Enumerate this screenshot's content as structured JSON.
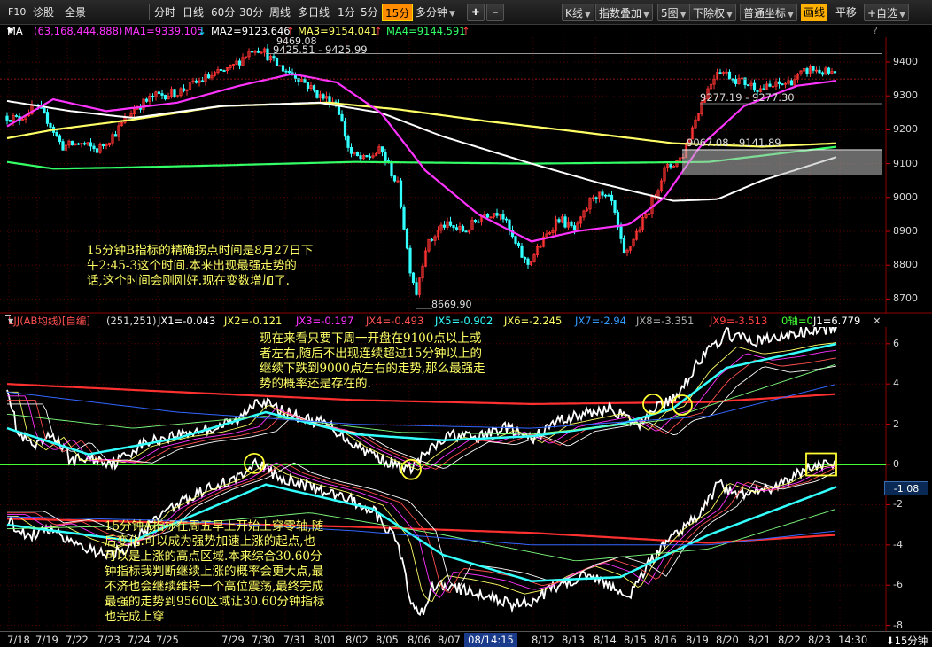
{
  "toolbar": {
    "f10": "F10",
    "diag": "诊股",
    "full": "全景",
    "fenshi": "分时",
    "rixian": "日线",
    "m60": "60分",
    "m30": "30分",
    "zhouxian": "周线",
    "duori": "多日线",
    "m1": "1分",
    "m5": "5分",
    "m15": "15分",
    "duofenzhong": "多分钟",
    "plus": "✚",
    "minus": "━",
    "kline": "K线",
    "index_overlay": "指数叠加",
    "five_charts": "5图",
    "adjust": "下除权",
    "coord": "普通坐标",
    "draw": "画线",
    "pan": "平移",
    "watchlist": "+自选"
  },
  "ma_legend": {
    "name": "MA",
    "params": "(63,168,444,888)",
    "ma1": "MA1=9339.105",
    "ma2": "MA2=9123.646",
    "ma3": "MA3=9154.041",
    "ma4": "MA4=9144.591",
    "help": "?"
  },
  "price_panel": {
    "y_ticks": [
      "9400",
      "9300",
      "9200",
      "9100",
      "9000",
      "8900",
      "8800",
      "8700"
    ],
    "high_label": "9469.08",
    "low_label": "8669.90",
    "range1": "9425.51 - 9425.99",
    "range2": "9277.19 - 9277.30",
    "range3": "9067.08 - 9141.89",
    "note": [
      "15分钟B指标的精确拐点时间是8月27日下",
      "午2:45-3这个时间.本来出现最强走势的",
      "话,这个时间会刚刚好.现在变数增加了."
    ]
  },
  "indicator_legend": {
    "selector": "LJJ(AB均线)[自编]",
    "params": "(251,251)",
    "jx1": "JX1=-0.043",
    "jx2": "JX2=-0.121",
    "jx3": "JX3=-0.197",
    "jx4": "JX4=-0.493",
    "jx5": "JX5=-0.902",
    "jx6": "JX6=-2.245",
    "jx7": "JX7=-2.94",
    "jx8": "JX8=-3.351",
    "jx9": "JX9=-3.513",
    "zero": "0轴=0",
    "j1": "J1=6.779",
    "close": "✕"
  },
  "indicator_panel": {
    "y_ticks": [
      "6",
      "4",
      "2",
      "0",
      "-2",
      "-4",
      "-6",
      "-8"
    ],
    "current_value": "-1.08",
    "note_top": [
      "现在来看只要下周一开盘在9100点以上或",
      "者左右,随后不出现连续超过15分钟以上的",
      "继续下跌到9000点左右的走势,那么最强走",
      "势的概率还是存在的."
    ],
    "note_bottom": [
      "15分钟A指标在周五早上开始上穿零轴,随",
      "后变化.可以成为强势加速上涨的起点,也",
      "可以是上涨的高点区域.本来综合30.60分",
      "钟指标我判断继续上涨的概率会更大点,最",
      "不济也会继续维持一个高位震荡,最终完成",
      "最强的走势到9560区域让30.60分钟指标",
      " 也完成上穿"
    ]
  },
  "date_axis": {
    "labels": [
      "7/18",
      "7/19",
      "7/22",
      "7/23",
      "7/24",
      "7/25",
      "7/29",
      "7/30",
      "7/31",
      "8/01",
      "8/02",
      "8/05",
      "8/06",
      "8/07",
      "8/12",
      "8/13",
      "8/14",
      "8/15",
      "8/16",
      "8/19",
      "8/20",
      "8/21",
      "8/22",
      "8/23",
      "14:30"
    ],
    "cursor": "08/14:15",
    "period": "⬇15分钟"
  },
  "colors": {
    "ma1": "#ff33ff",
    "ma2": "#ffffff",
    "ma3": "#ffff66",
    "ma4": "#33ff66",
    "up": "#ff3333",
    "down": "#33ffff",
    "zero_axis": "#44ff33"
  }
}
